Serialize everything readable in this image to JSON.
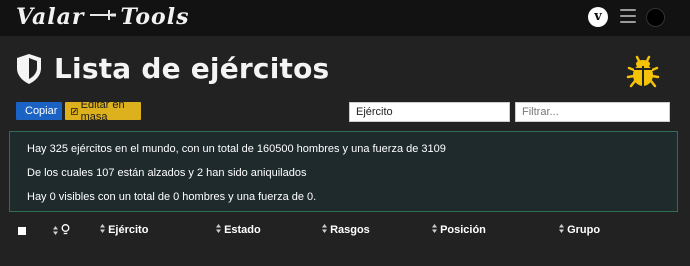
{
  "navbar": {
    "brand": {
      "left": "Valar",
      "right": "Tools"
    },
    "icons": [
      "vivaldi-icon",
      "hamburger-menu-icon",
      "avatar"
    ]
  },
  "header": {
    "title": "Lista de ejércitos",
    "icon": "shield-icon",
    "bug_icon": "bug-icon"
  },
  "toolbar": {
    "copy_label": "Copiar",
    "edit_label": "Editar en masa",
    "select_value": "Ejército",
    "filter_placeholder": "Filtrar..."
  },
  "info": {
    "line1": "Hay 325 ejércitos en el mundo, con un total de 160500 hombres y una fuerza de 3109",
    "line2": "De los cuales 107 están alzados y 2 han sido aniquilados",
    "line3": "Hay 0 visibles con un total de 0 hombres y una fuerza de 0."
  },
  "table": {
    "columns": [
      "Ejército",
      "Estado",
      "Rasgos",
      "Posición",
      "Grupo"
    ]
  },
  "colors": {
    "navbar_bg": "#121212",
    "page_bg": "#222222",
    "copy_button": "#1a63c4",
    "edit_button": "#ddb01d",
    "info_border": "#2f6e54",
    "bug_icon": "#f5c20a"
  }
}
